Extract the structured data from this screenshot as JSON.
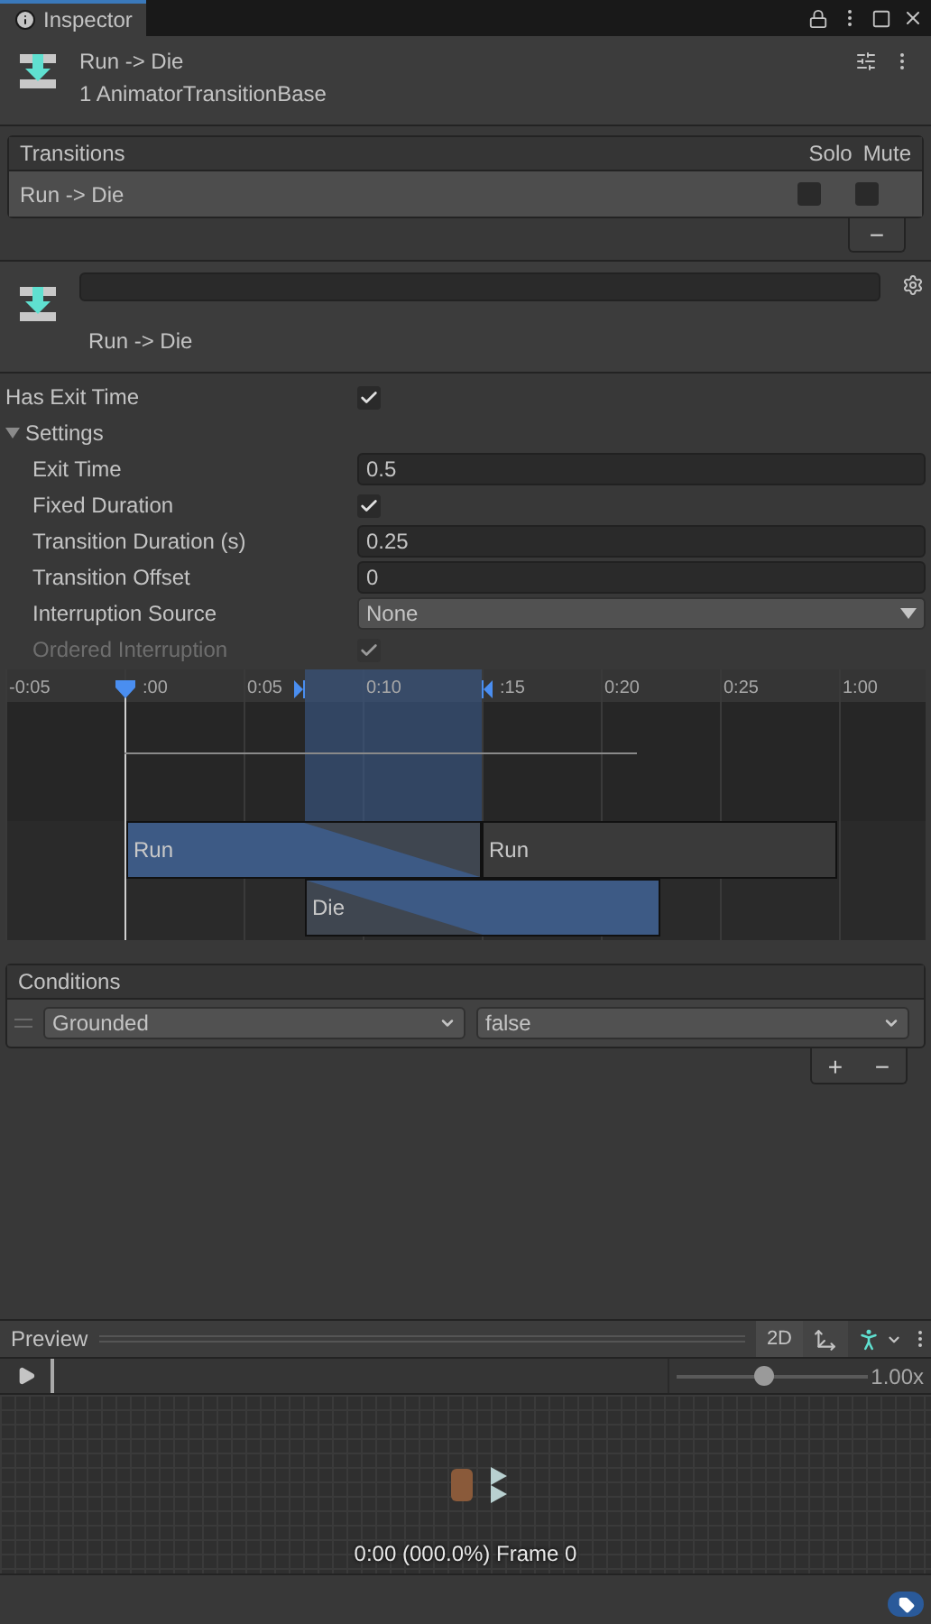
{
  "tab": {
    "title": "Inspector",
    "selected": true
  },
  "header": {
    "title": "Run -> Die",
    "subtitle": "1 AnimatorTransitionBase"
  },
  "transitions": {
    "title": "Transitions",
    "columns": [
      "Solo",
      "Mute"
    ],
    "rows": [
      {
        "name": "Run -> Die",
        "selected": true,
        "solo": false,
        "mute": false
      }
    ],
    "remove_button": "−"
  },
  "transition": {
    "label": "Run -> Die"
  },
  "has_exit_time": {
    "label": "Has Exit Time",
    "checked": true
  },
  "settings": {
    "label": "Settings",
    "expanded": true,
    "children": [
      {
        "kind": "field",
        "label": "Exit Time",
        "value": "0.5",
        "disabled": false
      },
      {
        "kind": "checkbox",
        "label": "Fixed Duration",
        "checked": true,
        "disabled": false
      },
      {
        "kind": "field",
        "label": "Transition Duration (s)",
        "value": "0.25",
        "disabled": false
      },
      {
        "kind": "field",
        "label": "Transition Offset",
        "value": "0",
        "disabled": false
      },
      {
        "kind": "dropdown",
        "label": "Interruption Source",
        "value": "None",
        "disabled": false
      },
      {
        "kind": "checkbox",
        "label": "Ordered Interruption",
        "checked": true,
        "disabled": true
      }
    ]
  },
  "timeline": {
    "ruler": [
      "-0:05",
      ":00",
      "0:05",
      "0:10",
      ":15",
      "0:20",
      "0:25",
      "1:00"
    ],
    "clips": [
      {
        "label": "Run",
        "kind": "source"
      },
      {
        "label": "Run",
        "kind": "next"
      },
      {
        "label": "Die",
        "kind": "destination"
      }
    ]
  },
  "conditions": {
    "title": "Conditions",
    "rows": [
      {
        "parameter": "Grounded",
        "value": "false"
      }
    ],
    "add_button": "+",
    "remove_button": "−"
  },
  "preview": {
    "title": "Preview",
    "mode_button": "2D",
    "speed_slider": {
      "level": 0.46
    },
    "speed": "1.00x",
    "readout": "0:00 (000.0%) Frame 0"
  }
}
